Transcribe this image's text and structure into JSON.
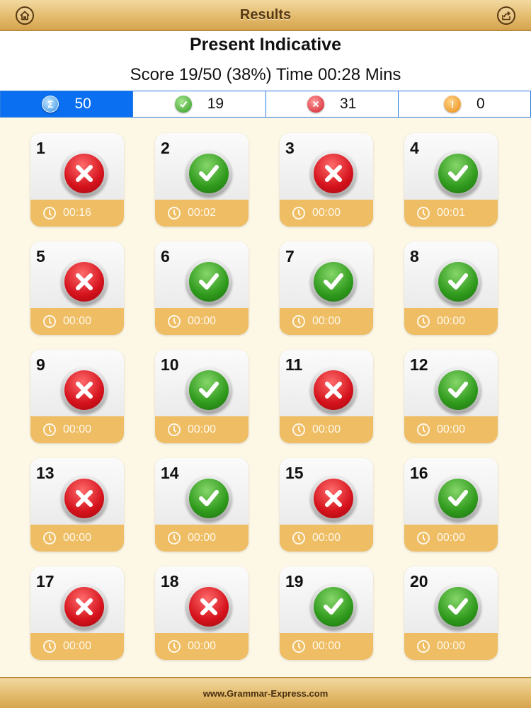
{
  "topbar": {
    "title": "Results",
    "home_icon": "home-icon",
    "share_icon": "share-icon"
  },
  "header": {
    "title": "Present Indicative",
    "score_line": "Score 19/50  (38%) Time 00:28 Mins"
  },
  "tabs": [
    {
      "name": "total",
      "icon": "sigma-icon",
      "count": "50",
      "active": true
    },
    {
      "name": "correct",
      "icon": "check-icon",
      "count": "19",
      "active": false
    },
    {
      "name": "wrong",
      "icon": "cross-icon",
      "count": "31",
      "active": false
    },
    {
      "name": "skipped",
      "icon": "exclamation-icon",
      "count": "0",
      "active": false
    }
  ],
  "questions": [
    {
      "num": "1",
      "result": "wrong",
      "time": "00:16"
    },
    {
      "num": "2",
      "result": "correct",
      "time": "00:02"
    },
    {
      "num": "3",
      "result": "wrong",
      "time": "00:00"
    },
    {
      "num": "4",
      "result": "correct",
      "time": "00:01"
    },
    {
      "num": "5",
      "result": "wrong",
      "time": "00:00"
    },
    {
      "num": "6",
      "result": "correct",
      "time": "00:00"
    },
    {
      "num": "7",
      "result": "correct",
      "time": "00:00"
    },
    {
      "num": "8",
      "result": "correct",
      "time": "00:00"
    },
    {
      "num": "9",
      "result": "wrong",
      "time": "00:00"
    },
    {
      "num": "10",
      "result": "correct",
      "time": "00:00"
    },
    {
      "num": "11",
      "result": "wrong",
      "time": "00:00"
    },
    {
      "num": "12",
      "result": "correct",
      "time": "00:00"
    },
    {
      "num": "13",
      "result": "wrong",
      "time": "00:00"
    },
    {
      "num": "14",
      "result": "correct",
      "time": "00:00"
    },
    {
      "num": "15",
      "result": "wrong",
      "time": "00:00"
    },
    {
      "num": "16",
      "result": "correct",
      "time": "00:00"
    },
    {
      "num": "17",
      "result": "wrong",
      "time": "00:00"
    },
    {
      "num": "18",
      "result": "wrong",
      "time": "00:00"
    },
    {
      "num": "19",
      "result": "correct",
      "time": "00:00"
    },
    {
      "num": "20",
      "result": "correct",
      "time": "00:00"
    }
  ],
  "footer": {
    "link": "www.Grammar-Express.com"
  },
  "colors": {
    "topbar": "#e2b96a",
    "active_tab": "#0a6ff0",
    "tile_footer": "#eebd64",
    "wrong": "#d4121c",
    "correct": "#2f9a1c",
    "background": "#fdf7e6"
  }
}
